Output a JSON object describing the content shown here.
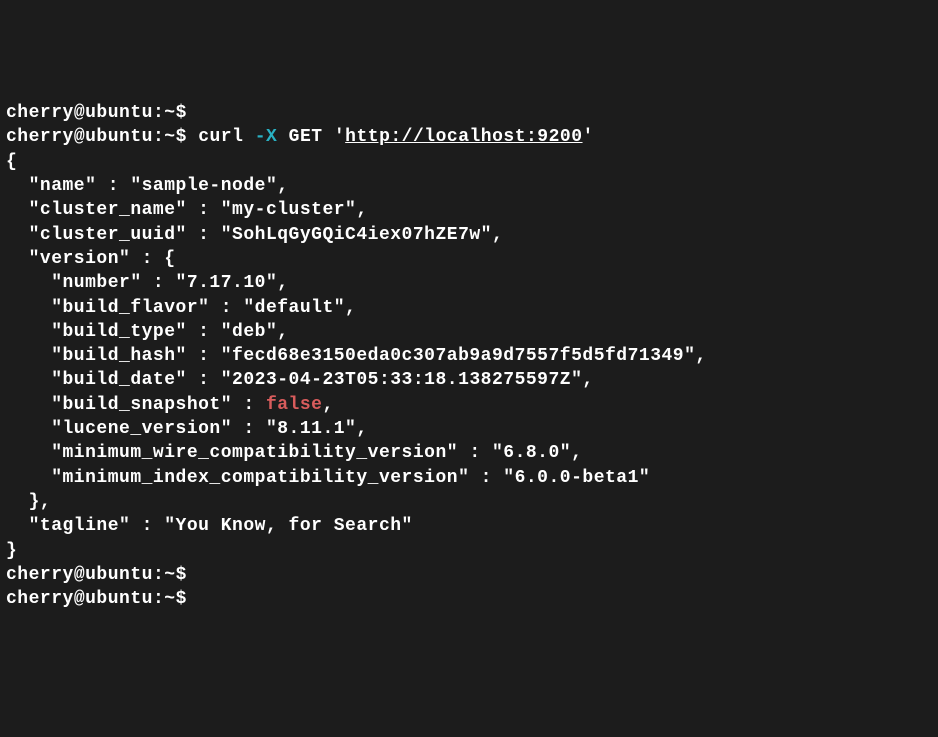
{
  "prompt": {
    "user": "cherry",
    "at": "@",
    "host": "ubuntu",
    "colon": ":",
    "path": "~",
    "dollar": "$"
  },
  "cmd": {
    "curl": "curl",
    "flag": "-X",
    "method": "GET",
    "quote1": "'",
    "url": "http://localhost:9200",
    "quote2": "'"
  },
  "out": {
    "open_brace": "{",
    "name_line": "  \"name\" : \"sample-node\",",
    "cluster_name_line": "  \"cluster_name\" : \"my-cluster\",",
    "cluster_uuid_line": "  \"cluster_uuid\" : \"SohLqGyGQiC4iex07hZE7w\",",
    "version_open": "  \"version\" : {",
    "number_line": "    \"number\" : \"7.17.10\",",
    "build_flavor_line": "    \"build_flavor\" : \"default\",",
    "build_type_line": "    \"build_type\" : \"deb\",",
    "build_hash_line": "    \"build_hash\" : \"fecd68e3150eda0c307ab9a9d7557f5d5fd71349\",",
    "build_date_line": "    \"build_date\" : \"2023-04-23T05:33:18.138275597Z\",",
    "build_snapshot_label": "    \"build_snapshot\" : ",
    "build_snapshot_false": "false",
    "build_snapshot_comma": ",",
    "lucene_line": "    \"lucene_version\" : \"8.11.1\",",
    "min_wire_line": "    \"minimum_wire_compatibility_version\" : \"6.8.0\",",
    "min_index_line": "    \"minimum_index_compatibility_version\" : \"6.0.0-beta1\"",
    "version_close": "  },",
    "tagline_line": "  \"tagline\" : \"You Know, for Search\"",
    "close_brace": "}"
  }
}
